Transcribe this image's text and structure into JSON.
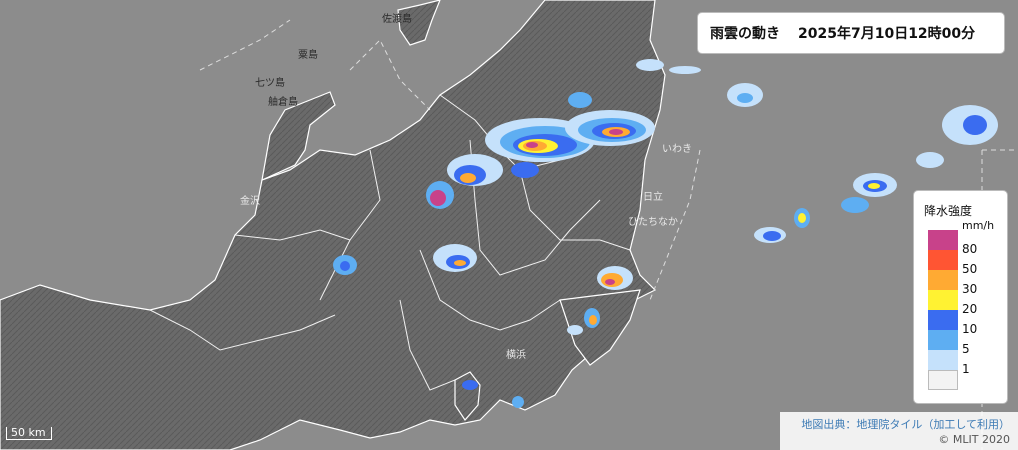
{
  "title": {
    "label": "雨雲の動き",
    "datetime": "2025年7月10日12時00分"
  },
  "legend": {
    "title": "降水強度",
    "unit": "mm/h",
    "levels": [
      {
        "label": "80",
        "color": "#c8428a"
      },
      {
        "label": "50",
        "color": "#ff5533"
      },
      {
        "label": "30",
        "color": "#ffaa33"
      },
      {
        "label": "20",
        "color": "#fff232"
      },
      {
        "label": "10",
        "color": "#3a6cf0"
      },
      {
        "label": "5",
        "color": "#5eaef2"
      },
      {
        "label": "1",
        "color": "#c5e1fb"
      },
      {
        "label": "",
        "color": "#f3f3f3"
      }
    ]
  },
  "scale_bar": {
    "label": "50 km"
  },
  "attribution": {
    "source": "地図出典：地理院タイル（加工して利用）",
    "copyright": "© MLIT 2020"
  },
  "places": {
    "sado": "佐渡島",
    "awashima": "粟島",
    "nanatsu": "七ツ島",
    "hegura": "舳倉島",
    "kanazawa": "金沢",
    "hitachi": "日立",
    "hitachinaka": "ひたちなか",
    "iwaki": "いわき",
    "yokohama": "横浜"
  },
  "colors": {
    "land": "#6e6e6e",
    "sea": "#8c8c8c",
    "boundary": "#ffffff",
    "r80": "#c8428a",
    "r50": "#ff5533",
    "r30": "#ffaa33",
    "r20": "#fff232",
    "r10": "#3a6cf0",
    "r5": "#5eaef2",
    "r1": "#c5e1fb"
  }
}
